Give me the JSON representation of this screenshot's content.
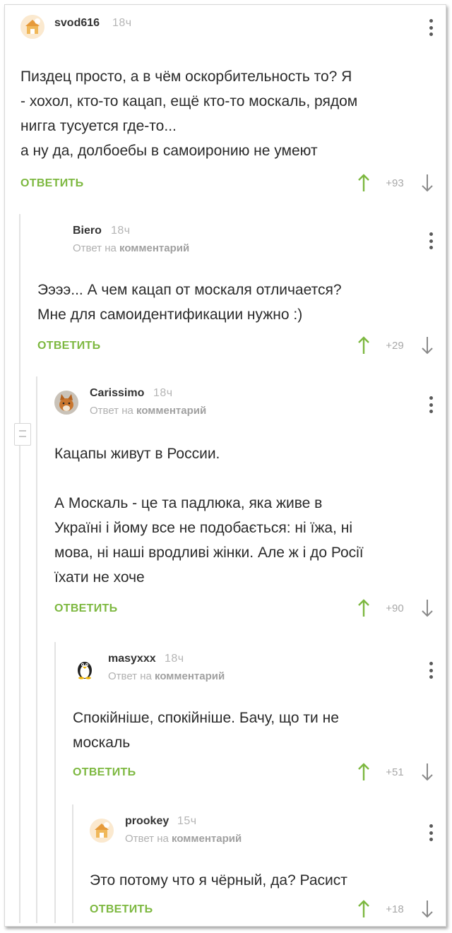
{
  "comments": [
    {
      "username": "svod616",
      "time": "18ч",
      "reply_to": "",
      "text": "Пиздец просто, а в чём оскорбительность то? Я\n- хохол, кто-то кацап, ещё кто-то москаль, рядом\nнигга тусуется где-то...\nа ну да, долбоебы в самоиронию не умеют",
      "reply_label": "ОТВЕТИТЬ",
      "rating": "+93",
      "avatar": "cat-house-avatar"
    },
    {
      "username": "Biero",
      "time": "18ч",
      "reply_to": "Ответ на",
      "reply_to_target": "комментарий",
      "text": "Ээээ... А чем кацап от москаля отличается?\nМне для самоидентификации нужно :)",
      "reply_label": "ОТВЕТИТЬ",
      "rating": "+29",
      "avatar": "none"
    },
    {
      "username": "Carissimo",
      "time": "18ч",
      "reply_to": "Ответ на",
      "reply_to_target": "комментарий",
      "text": "Кацапы живут в России.\n\nА Москаль - це та падлюка, яка живе в\nУкраїні і йому все не подобається: ні їжа, ні\nмова, ні наші вродливі жінки. Але ж і до Росії\nїхати не хоче",
      "reply_label": "ОТВЕТИТЬ",
      "rating": "+90",
      "avatar": "fox-avatar"
    },
    {
      "username": "masyxxx",
      "time": "18ч",
      "reply_to": "Ответ на",
      "reply_to_target": "комментарий",
      "text": "Спокійніше, спокійніше.  Бачу, що ти не\nмоскаль",
      "reply_label": "ОТВЕТИТЬ",
      "rating": "+51",
      "avatar": "penguin-avatar"
    },
    {
      "username": "prookey",
      "time": "15ч",
      "reply_to": "Ответ на",
      "reply_to_target": "комментарий",
      "text": "Это потому что я чёрный, да? Расист",
      "reply_label": "ОТВЕТИТЬ",
      "rating": "+18",
      "avatar": "cat-house-avatar"
    }
  ],
  "colors": {
    "reply_green": "#7db840",
    "vote_up_green": "#7db840",
    "vote_down_gray": "#8a8a8a",
    "thread_line": "#e3e3e3"
  },
  "icons": {
    "up": "arrow-up-icon",
    "down": "arrow-down-icon",
    "more": "more-vertical-icon"
  }
}
